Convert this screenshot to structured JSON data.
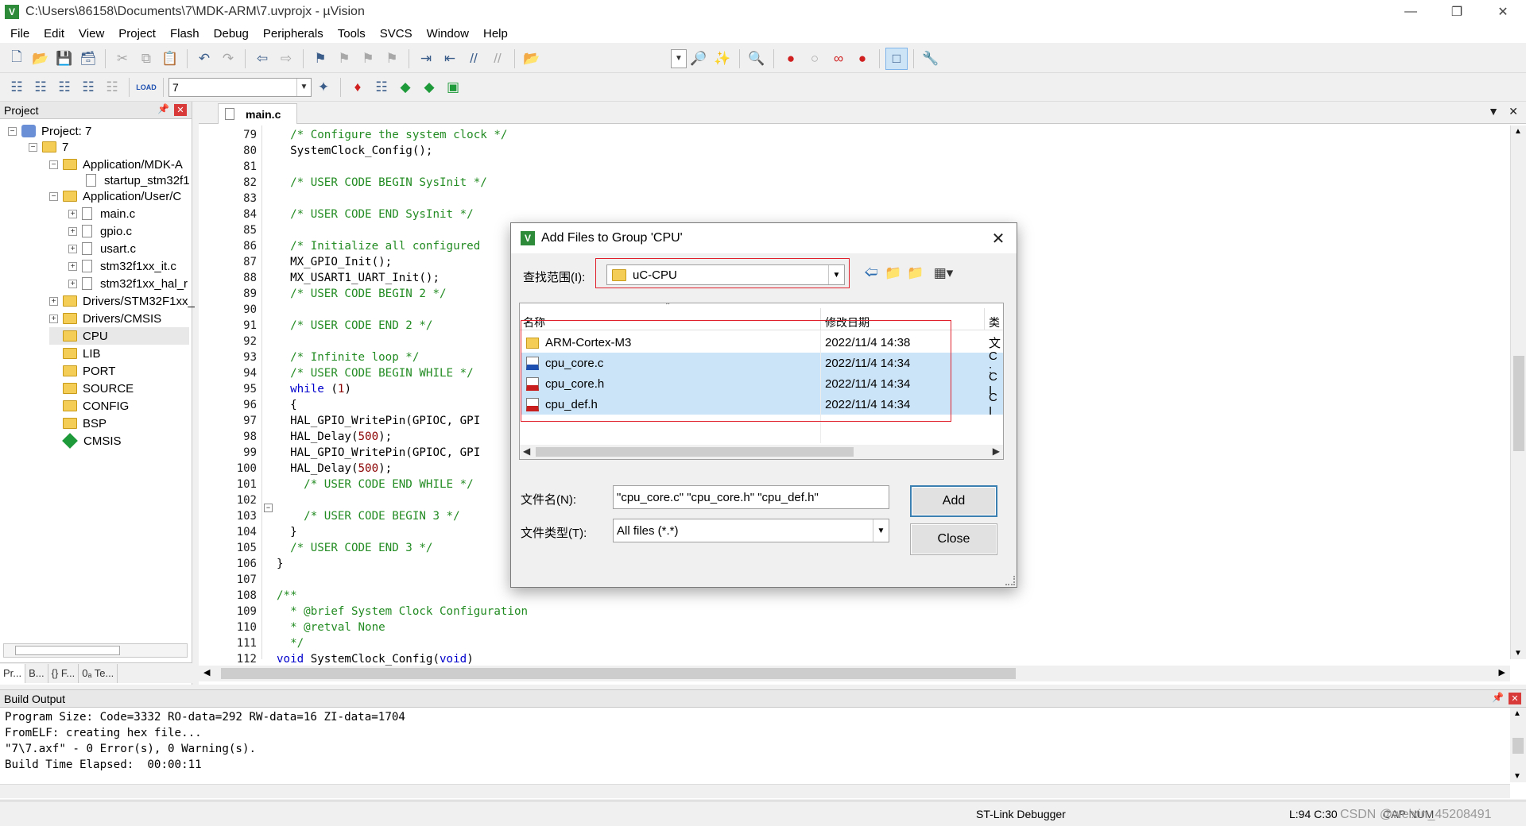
{
  "window": {
    "title": "C:\\Users\\86158\\Documents\\7\\MDK-ARM\\7.uvprojx - µVision",
    "icon_letter": "V"
  },
  "menu": [
    "File",
    "Edit",
    "View",
    "Project",
    "Flash",
    "Debug",
    "Peripherals",
    "Tools",
    "SVCS",
    "Window",
    "Help"
  ],
  "toolbar2": {
    "target": "7",
    "load_label": "LOAD"
  },
  "project_panel": {
    "title": "Project",
    "root": "Project: 7",
    "target": "7",
    "groups": [
      {
        "label": "Application/MDK-A"
      },
      {
        "label": "startup_stm32f1"
      },
      {
        "label": "Application/User/C"
      },
      {
        "label": "main.c"
      },
      {
        "label": "gpio.c"
      },
      {
        "label": "usart.c"
      },
      {
        "label": "stm32f1xx_it.c"
      },
      {
        "label": "stm32f1xx_hal_r"
      },
      {
        "label": "Drivers/STM32F1xx_"
      },
      {
        "label": "Drivers/CMSIS"
      },
      {
        "label": "CPU"
      },
      {
        "label": "LIB"
      },
      {
        "label": "PORT"
      },
      {
        "label": "SOURCE"
      },
      {
        "label": "CONFIG"
      },
      {
        "label": "BSP"
      },
      {
        "label": "CMSIS"
      }
    ],
    "tabs": [
      "Pr...",
      "B...",
      "{} F...",
      "0ₐ Te..."
    ]
  },
  "editor": {
    "tab": "main.c",
    "lines": [
      {
        "n": "79",
        "t": "  /* Configure the system clock */"
      },
      {
        "n": "80",
        "t": "  SystemClock_Config();"
      },
      {
        "n": "81",
        "t": ""
      },
      {
        "n": "82",
        "t": "  /* USER CODE BEGIN SysInit */"
      },
      {
        "n": "83",
        "t": ""
      },
      {
        "n": "84",
        "t": "  /* USER CODE END SysInit */"
      },
      {
        "n": "85",
        "t": ""
      },
      {
        "n": "86",
        "t": "  /* Initialize all configured"
      },
      {
        "n": "87",
        "t": "  MX_GPIO_Init();"
      },
      {
        "n": "88",
        "t": "  MX_USART1_UART_Init();"
      },
      {
        "n": "89",
        "t": "  /* USER CODE BEGIN 2 */"
      },
      {
        "n": "90",
        "t": ""
      },
      {
        "n": "91",
        "t": "  /* USER CODE END 2 */"
      },
      {
        "n": "92",
        "t": ""
      },
      {
        "n": "93",
        "t": "  /* Infinite loop */"
      },
      {
        "n": "94",
        "t": "  /* USER CODE BEGIN WHILE */"
      },
      {
        "n": "95",
        "t": "  while (1)"
      },
      {
        "n": "96",
        "t": "  {"
      },
      {
        "n": "97",
        "t": "  HAL_GPIO_WritePin(GPIOC, GPI"
      },
      {
        "n": "98",
        "t": "  HAL_Delay(500);"
      },
      {
        "n": "99",
        "t": "  HAL_GPIO_WritePin(GPIOC, GPI"
      },
      {
        "n": "100",
        "t": "  HAL_Delay(500);"
      },
      {
        "n": "101",
        "t": "    /* USER CODE END WHILE */"
      },
      {
        "n": "102",
        "t": ""
      },
      {
        "n": "103",
        "t": "    /* USER CODE BEGIN 3 */"
      },
      {
        "n": "104",
        "t": "  }"
      },
      {
        "n": "105",
        "t": "  /* USER CODE END 3 */"
      },
      {
        "n": "106",
        "t": "}"
      },
      {
        "n": "107",
        "t": ""
      },
      {
        "n": "108",
        "t": "/**"
      },
      {
        "n": "109",
        "t": "  * @brief System Clock Configuration"
      },
      {
        "n": "110",
        "t": "  * @retval None"
      },
      {
        "n": "111",
        "t": "  */"
      },
      {
        "n": "112",
        "t": "void SystemClock_Config(void)"
      }
    ]
  },
  "build_output": {
    "title": "Build Output",
    "lines": [
      "Program Size: Code=3332 RO-data=292 RW-data=16 ZI-data=1704",
      "FromELF: creating hex file...",
      "\"7\\7.axf\" - 0 Error(s), 0 Warning(s).",
      "Build Time Elapsed:  00:00:11"
    ]
  },
  "status": {
    "debugger": "ST-Link Debugger",
    "cursor": "L:94 C:30",
    "caps": "CAP NUM",
    "watermark": "CSDN @weixin_45208491"
  },
  "dialog": {
    "title": "Add Files to Group 'CPU'",
    "lookin_label": "查找范围(I):",
    "lookin_value": "uC-CPU",
    "columns": {
      "name": "名称",
      "date": "修改日期",
      "type": "类"
    },
    "files": [
      {
        "name": "ARM-Cortex-M3",
        "date": "2022/11/4 14:38",
        "type": "文",
        "kind": "folder",
        "selected": false
      },
      {
        "name": "cpu_core.c",
        "date": "2022/11/4 14:34",
        "type": "C :",
        "kind": "c",
        "selected": true
      },
      {
        "name": "cpu_core.h",
        "date": "2022/11/4 14:34",
        "type": "C I",
        "kind": "h",
        "selected": true
      },
      {
        "name": "cpu_def.h",
        "date": "2022/11/4 14:34",
        "type": "C I",
        "kind": "h",
        "selected": true
      }
    ],
    "filename_label": "文件名(N):",
    "filename_value": "\"cpu_core.c\" \"cpu_core.h\" \"cpu_def.h\"",
    "filetype_label": "文件类型(T):",
    "filetype_value": "All files (*.*)",
    "add_button": "Add",
    "close_button": "Close"
  }
}
